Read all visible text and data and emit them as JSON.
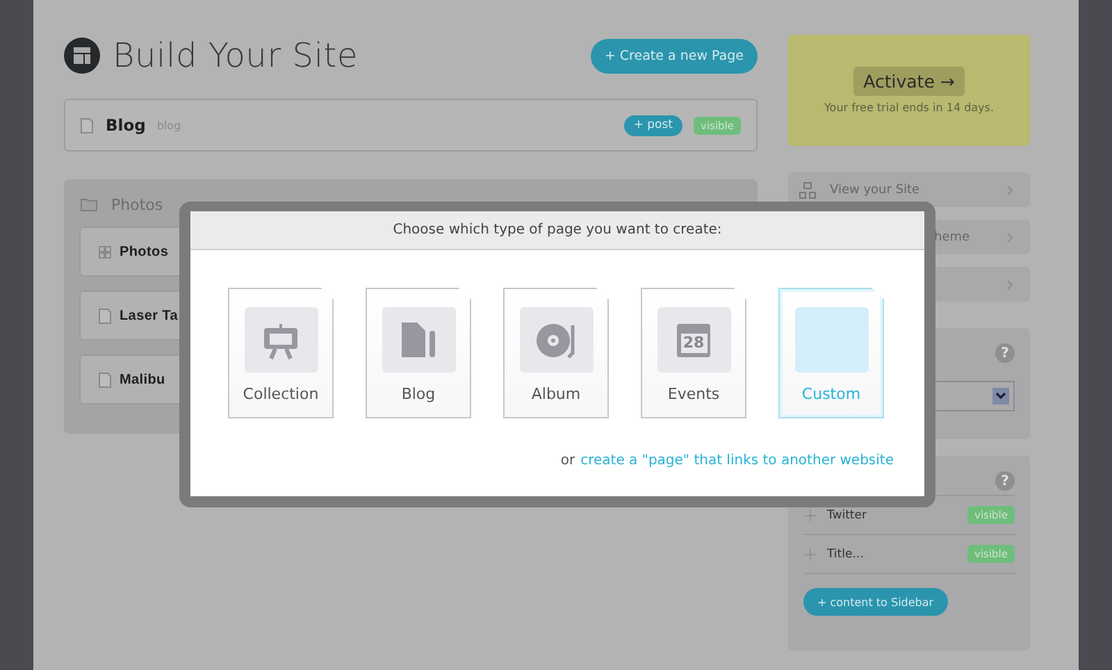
{
  "header": {
    "title": "Build Your Site",
    "create_button": "+ Create a new Page"
  },
  "pages": [
    {
      "name": "Blog",
      "slug": "blog",
      "action": "+ post",
      "status": "visible"
    }
  ],
  "folder": {
    "name": "Photos",
    "items": [
      {
        "kind": "gallery",
        "name": "Photos"
      },
      {
        "kind": "page",
        "name": "Laser Ta"
      },
      {
        "kind": "page",
        "name": "Malibu"
      }
    ]
  },
  "trial": {
    "button": "Activate →",
    "note": "Your free trial ends in 14 days."
  },
  "links": [
    {
      "kind": "site",
      "label": "View your Site"
    },
    {
      "kind": "theme",
      "label": "heme"
    },
    {
      "kind": "other"
    }
  ],
  "settings_panel": {
    "help": "?"
  },
  "sidebar": {
    "help": "?",
    "items": [
      {
        "name": "Twitter",
        "status": "visible"
      },
      {
        "name": "Title...",
        "status": "visible"
      }
    ],
    "add_button": "+ content to Sidebar"
  },
  "dialog": {
    "title": "Choose which type of page you want to create:",
    "types": [
      {
        "kind": "collection",
        "label": "Collection",
        "selected": false
      },
      {
        "kind": "blog",
        "label": "Blog",
        "selected": false
      },
      {
        "kind": "album",
        "label": "Album",
        "selected": false
      },
      {
        "kind": "events",
        "label": "Events",
        "selected": false,
        "icon_text": "28"
      },
      {
        "kind": "custom",
        "label": "Custom",
        "selected": true
      }
    ],
    "footer_prefix": "or",
    "footer_link": "create a \"page\" that links to another website"
  }
}
